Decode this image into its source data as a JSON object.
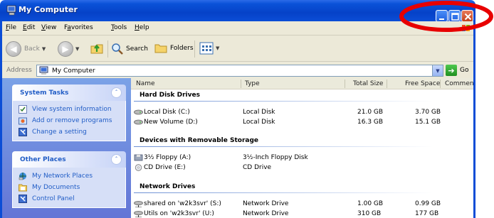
{
  "window": {
    "title": "My Computer",
    "controls": {
      "minimize": "minimize",
      "maximize": "maximize",
      "close": "close"
    }
  },
  "menu": [
    {
      "u": "F",
      "rest": "ile"
    },
    {
      "u": "E",
      "rest": "dit"
    },
    {
      "u": "V",
      "rest": "iew"
    },
    {
      "pre": "F",
      "u": "a",
      "rest": "vorites"
    },
    {
      "u": "T",
      "rest": "ools"
    },
    {
      "u": "H",
      "rest": "elp"
    }
  ],
  "toolbar": {
    "back": "Back",
    "search": "Search",
    "folders": "Folders"
  },
  "address": {
    "label": "Address",
    "value": "My Computer",
    "go": "Go"
  },
  "system_tasks": {
    "title": "System Tasks",
    "items": [
      {
        "label": "View system information",
        "icon": "info-icon"
      },
      {
        "label": "Add or remove programs",
        "icon": "programs-icon"
      },
      {
        "label": "Change a setting",
        "icon": "control-panel-icon"
      }
    ]
  },
  "other_places": {
    "title": "Other Places",
    "items": [
      {
        "label": "My Network Places",
        "icon": "network-icon"
      },
      {
        "label": "My Documents",
        "icon": "folder-icon"
      },
      {
        "label": "Control Panel",
        "icon": "control-panel-icon"
      }
    ]
  },
  "columns": [
    "Name",
    "Type",
    "Total Size",
    "Free Space",
    "Comments"
  ],
  "groups": {
    "hard": "Hard Disk Drives",
    "removable": "Devices with Removable Storage",
    "network": "Network Drives"
  },
  "rows": {
    "hard": [
      {
        "name": "Local Disk (C:)",
        "type": "Local Disk",
        "total": "21.0 GB",
        "free": "3.70 GB"
      },
      {
        "name": "New Volume (D:)",
        "type": "Local Disk",
        "total": "16.3 GB",
        "free": "15.1 GB"
      }
    ],
    "removable": [
      {
        "name": "3½ Floppy (A:)",
        "type": "3½-Inch Floppy Disk"
      },
      {
        "name": "CD Drive (E:)",
        "type": "CD Drive"
      }
    ],
    "network": [
      {
        "name": "shared on 'w2k3svr' (S:)",
        "type": "Network Drive",
        "total": "1.00 GB",
        "free": "0.99 GB"
      },
      {
        "name": "Utils on 'w2k3svr' (U:)",
        "type": "Network Drive",
        "total": "310 GB",
        "free": "177 GB"
      }
    ]
  },
  "colors": {
    "titlebar": "#0b4dd6",
    "taskpane": "#6375d6",
    "highlight": "#e80000"
  }
}
